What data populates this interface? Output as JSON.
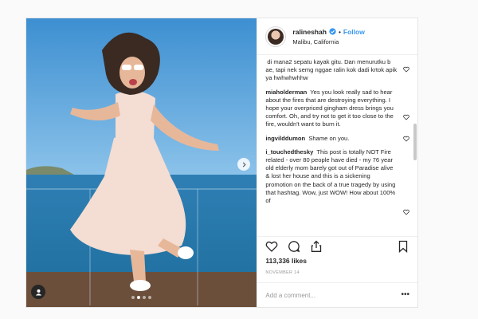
{
  "post": {
    "username": "ralineshah",
    "separator": "•",
    "follow_label": "Follow",
    "location": "Malibu, California",
    "likes": "113,336 likes",
    "date": "NOVEMBER 14",
    "comment_placeholder": "Add a comment...",
    "more_label": "•••",
    "carousel": {
      "total": 4,
      "active_index": 1
    }
  },
  "comments": [
    {
      "user": "",
      "text": "di mana2 sepatu kayak gitu. Dan menurutku b ae, tapi nek semg nggae ralin kok dadi krtok apik ya hwhwhwhhw"
    },
    {
      "user": "miaholderman",
      "text": "Yes you look really sad to hear about the fires that are destroying everything. I hope your overpriced gingham dress brings you comfort. Oh, and try not to get it too close to the fire, wouldn't want to burn it."
    },
    {
      "user": "ingvilddumon",
      "text": "Shame on you."
    },
    {
      "user": "i_touchedthesky",
      "text": "This post is totally NOT Fire related - over 80 people have died - my 76 year old elderly mom barely got out of Paradise alive & lost her house and this is a sickening promotion on the back of a true tragedy by using that hashtag. Wow, just WOW! How about 100% of"
    }
  ],
  "icons": {
    "verified": "verified-badge-icon",
    "heart": "heart-icon",
    "comment": "comment-icon",
    "share": "share-icon",
    "bookmark": "bookmark-icon",
    "user_tag": "user-tag-icon",
    "next": "chevron-right-icon"
  },
  "colors": {
    "accent": "#3897f0",
    "text": "#262626",
    "muted": "#999999",
    "border": "#efefef"
  }
}
